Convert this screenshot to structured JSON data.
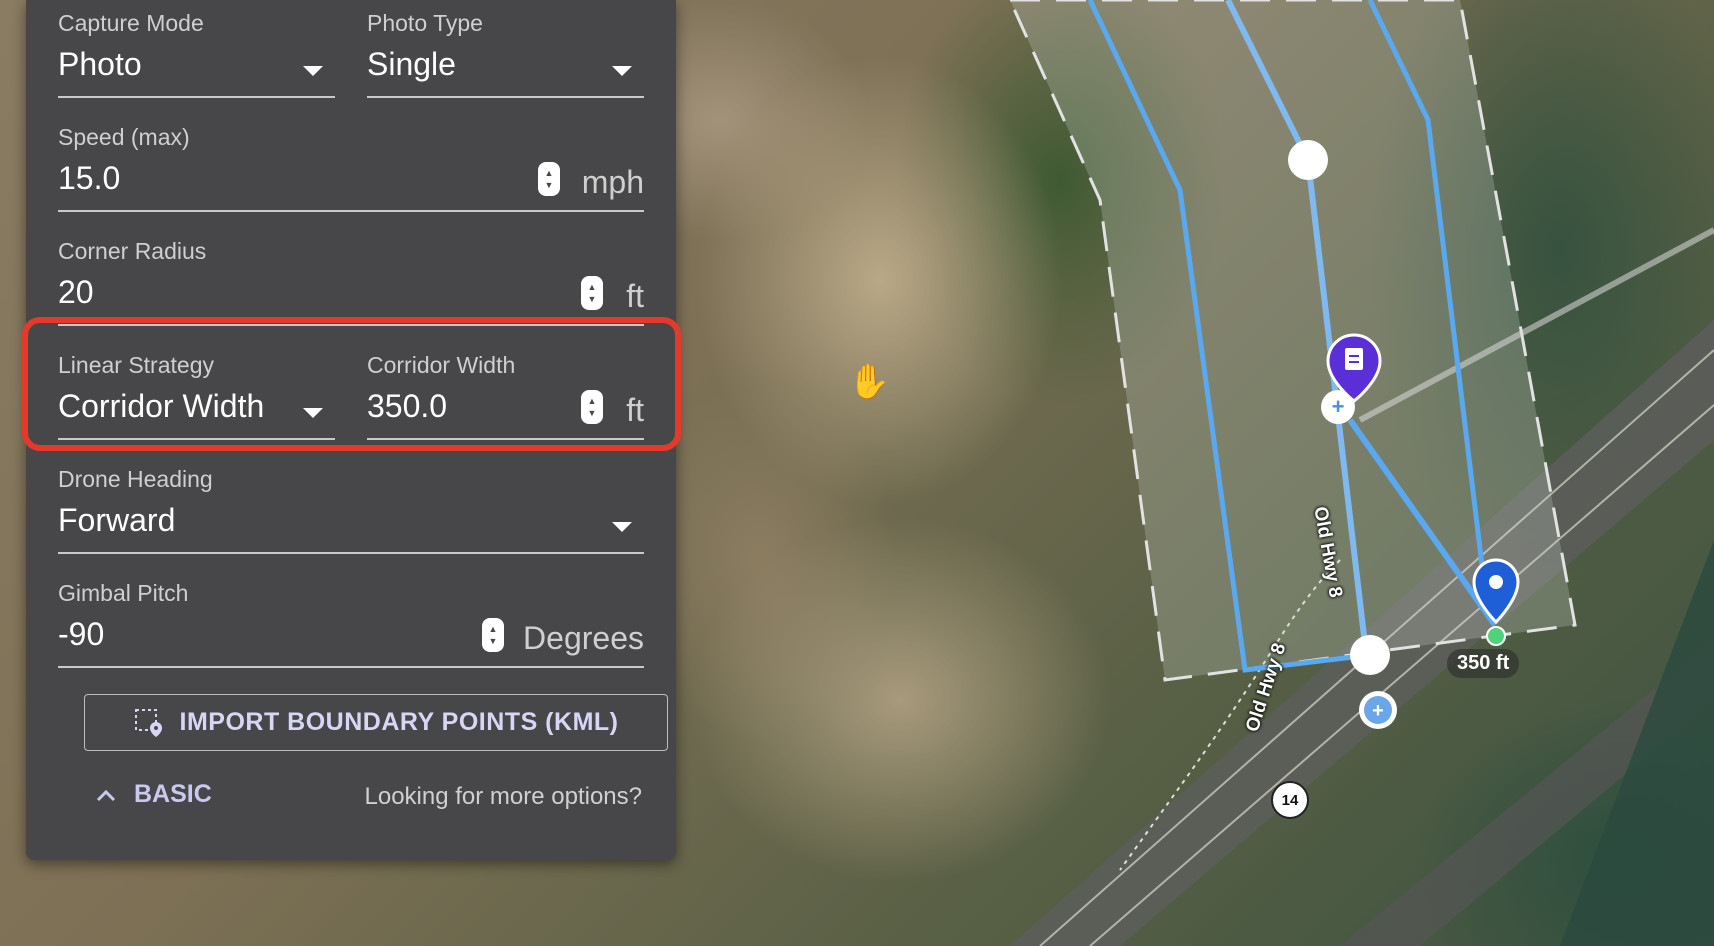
{
  "panel": {
    "capture_mode": {
      "label": "Capture Mode",
      "value": "Photo"
    },
    "photo_type": {
      "label": "Photo Type",
      "value": "Single"
    },
    "speed": {
      "label": "Speed (max)",
      "value": "15.0",
      "unit": "mph"
    },
    "corner_radius": {
      "label": "Corner Radius",
      "value": "20",
      "unit": "ft"
    },
    "linear_strategy": {
      "label": "Linear Strategy",
      "value": "Corridor Width"
    },
    "corridor_width": {
      "label": "Corridor Width",
      "value": "350.0",
      "unit": "ft"
    },
    "drone_heading": {
      "label": "Drone Heading",
      "value": "Forward"
    },
    "gimbal_pitch": {
      "label": "Gimbal Pitch",
      "value": "-90",
      "unit": "Degrees"
    },
    "import_button": {
      "label": "IMPORT BOUNDARY POINTS (KML)",
      "icon": "boundary-pin-icon"
    },
    "basic_toggle": {
      "label": "BASIC",
      "icon": "chevron-up-icon"
    },
    "more_options": "Looking for more options?"
  },
  "map": {
    "road_label_1": "Old Hwy 8",
    "road_label_2": "Old Hwy 8",
    "distance_label": "350 ft",
    "route_shield": "14",
    "colors": {
      "flight_path": "#5aa9f0",
      "corridor": "#cfd8d0",
      "waypoint_marker": "#1e5fd8",
      "task_marker": "#5a2fd8",
      "highlight": "#e53a2b"
    }
  }
}
